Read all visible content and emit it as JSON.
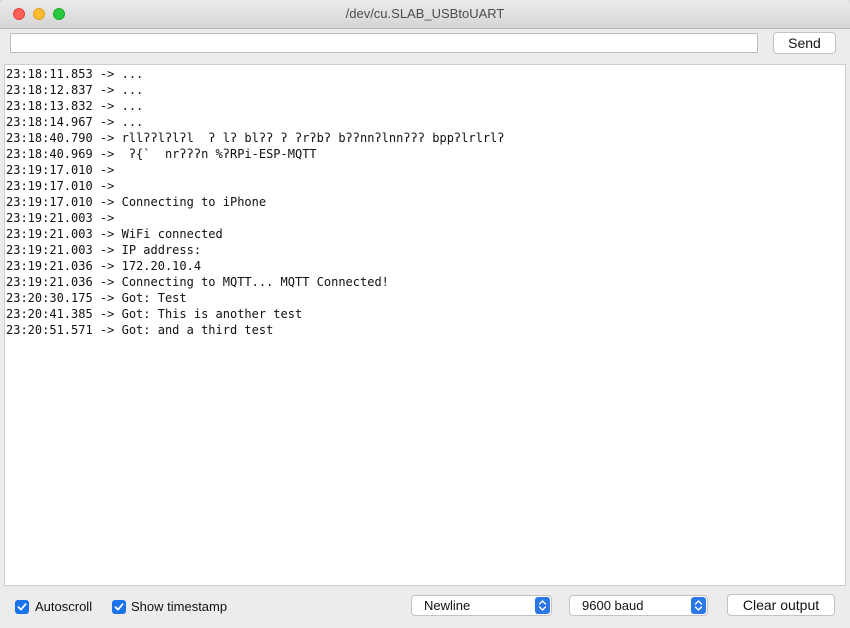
{
  "window": {
    "title": "/dev/cu.SLAB_USBtoUART"
  },
  "input": {
    "value": "",
    "placeholder": ""
  },
  "send_label": "Send",
  "log_lines": [
    "23:18:11.853 -> ...",
    "23:18:12.837 -> ...",
    "23:18:13.832 -> ...",
    "23:18:14.967 -> ...",
    "23:18:40.790 -> rllʔʔlʔlʔl  ʔ lʔ blʔʔ ʔ ʔrʔbʔ bʔʔnnʔlnnʔʔʔ bppʔlrlrlʔ",
    "23:18:40.969 ->  ʔ{`  nrʔʔʔn %ʔRPi-ESP-MQTT",
    "23:19:17.010 ->",
    "23:19:17.010 ->",
    "23:19:17.010 -> Connecting to iPhone",
    "23:19:21.003 ->",
    "23:19:21.003 -> WiFi connected",
    "23:19:21.003 -> IP address:",
    "23:19:21.036 -> 172.20.10.4",
    "23:19:21.036 -> Connecting to MQTT... MQTT Connected!",
    "23:20:30.175 -> Got: Test",
    "23:20:41.385 -> Got: This is another test",
    "23:20:51.571 -> Got: and a third test"
  ],
  "footer": {
    "autoscroll": {
      "label": "Autoscroll",
      "checked": true
    },
    "show_timestamp": {
      "label": "Show timestamp",
      "checked": true
    },
    "line_ending": "Newline",
    "baud": "9600 baud",
    "clear_label": "Clear output"
  },
  "colors": {
    "accent": "#2b77e6",
    "close": "#fe5f57",
    "minimize": "#febc2e",
    "maximize": "#28c840"
  },
  "icons": [
    "close-traffic-light",
    "minimize-traffic-light",
    "maximize-traffic-light",
    "checkmark-icon",
    "updown-chevron-icon"
  ]
}
